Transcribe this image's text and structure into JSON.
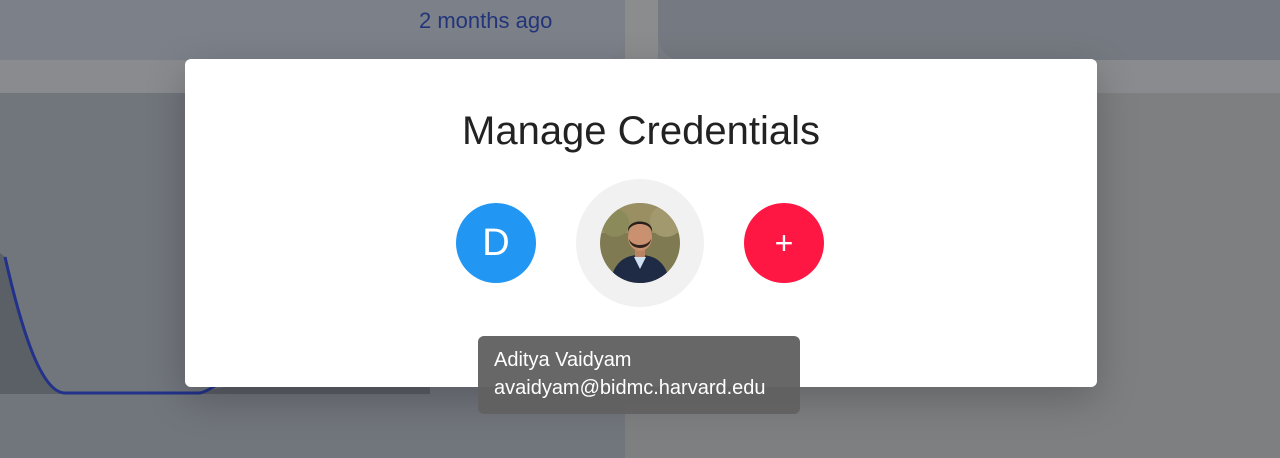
{
  "background": {
    "timestamp": "2 months ago"
  },
  "modal": {
    "title": "Manage Credentials",
    "accounts": [
      {
        "initial": "D",
        "color": "#2196f3"
      }
    ],
    "add_label": "+",
    "add_color": "#ff1744"
  },
  "tooltip": {
    "name": "Aditya Vaidyam",
    "email": "avaidyam@bidmc.harvard.edu"
  }
}
